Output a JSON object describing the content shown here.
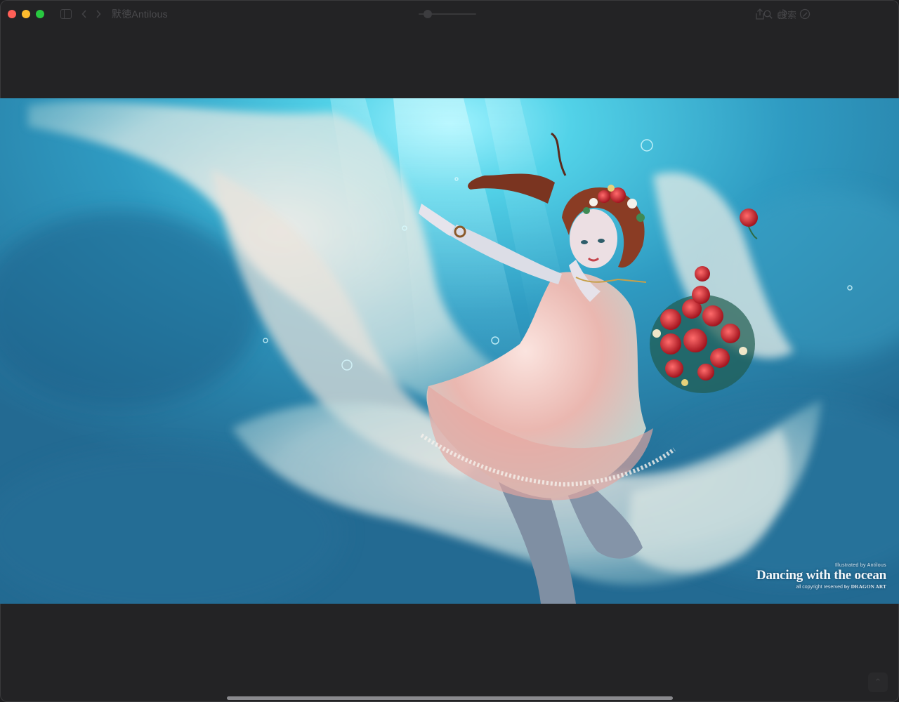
{
  "window": {
    "title": "默徳Antilous"
  },
  "toolbar": {
    "sidebar_icon": "sidebar-icon",
    "back_icon": "chevron-left-icon",
    "forward_icon": "chevron-right-icon",
    "zoom_level": 0.1,
    "right_icons": [
      "share-icon",
      "rotate-icon",
      "markup-icon"
    ],
    "search_icon": "search-icon",
    "search_placeholder": "搜索"
  },
  "image": {
    "credit": "Illustrated by Antilous",
    "title": "Dancing with the ocean",
    "copyright_prefix": "all copyright reserved",
    "copyright_by": "by DRAGON ART"
  },
  "colors": {
    "window_bg": "#232325",
    "ocean_deep": "#2b6d94",
    "ocean_light": "#5fd8ea",
    "rose": "#d8323a"
  },
  "footer": {
    "corner_icon": "corner-arrow-icon",
    "corner_glyph": "⌃"
  }
}
